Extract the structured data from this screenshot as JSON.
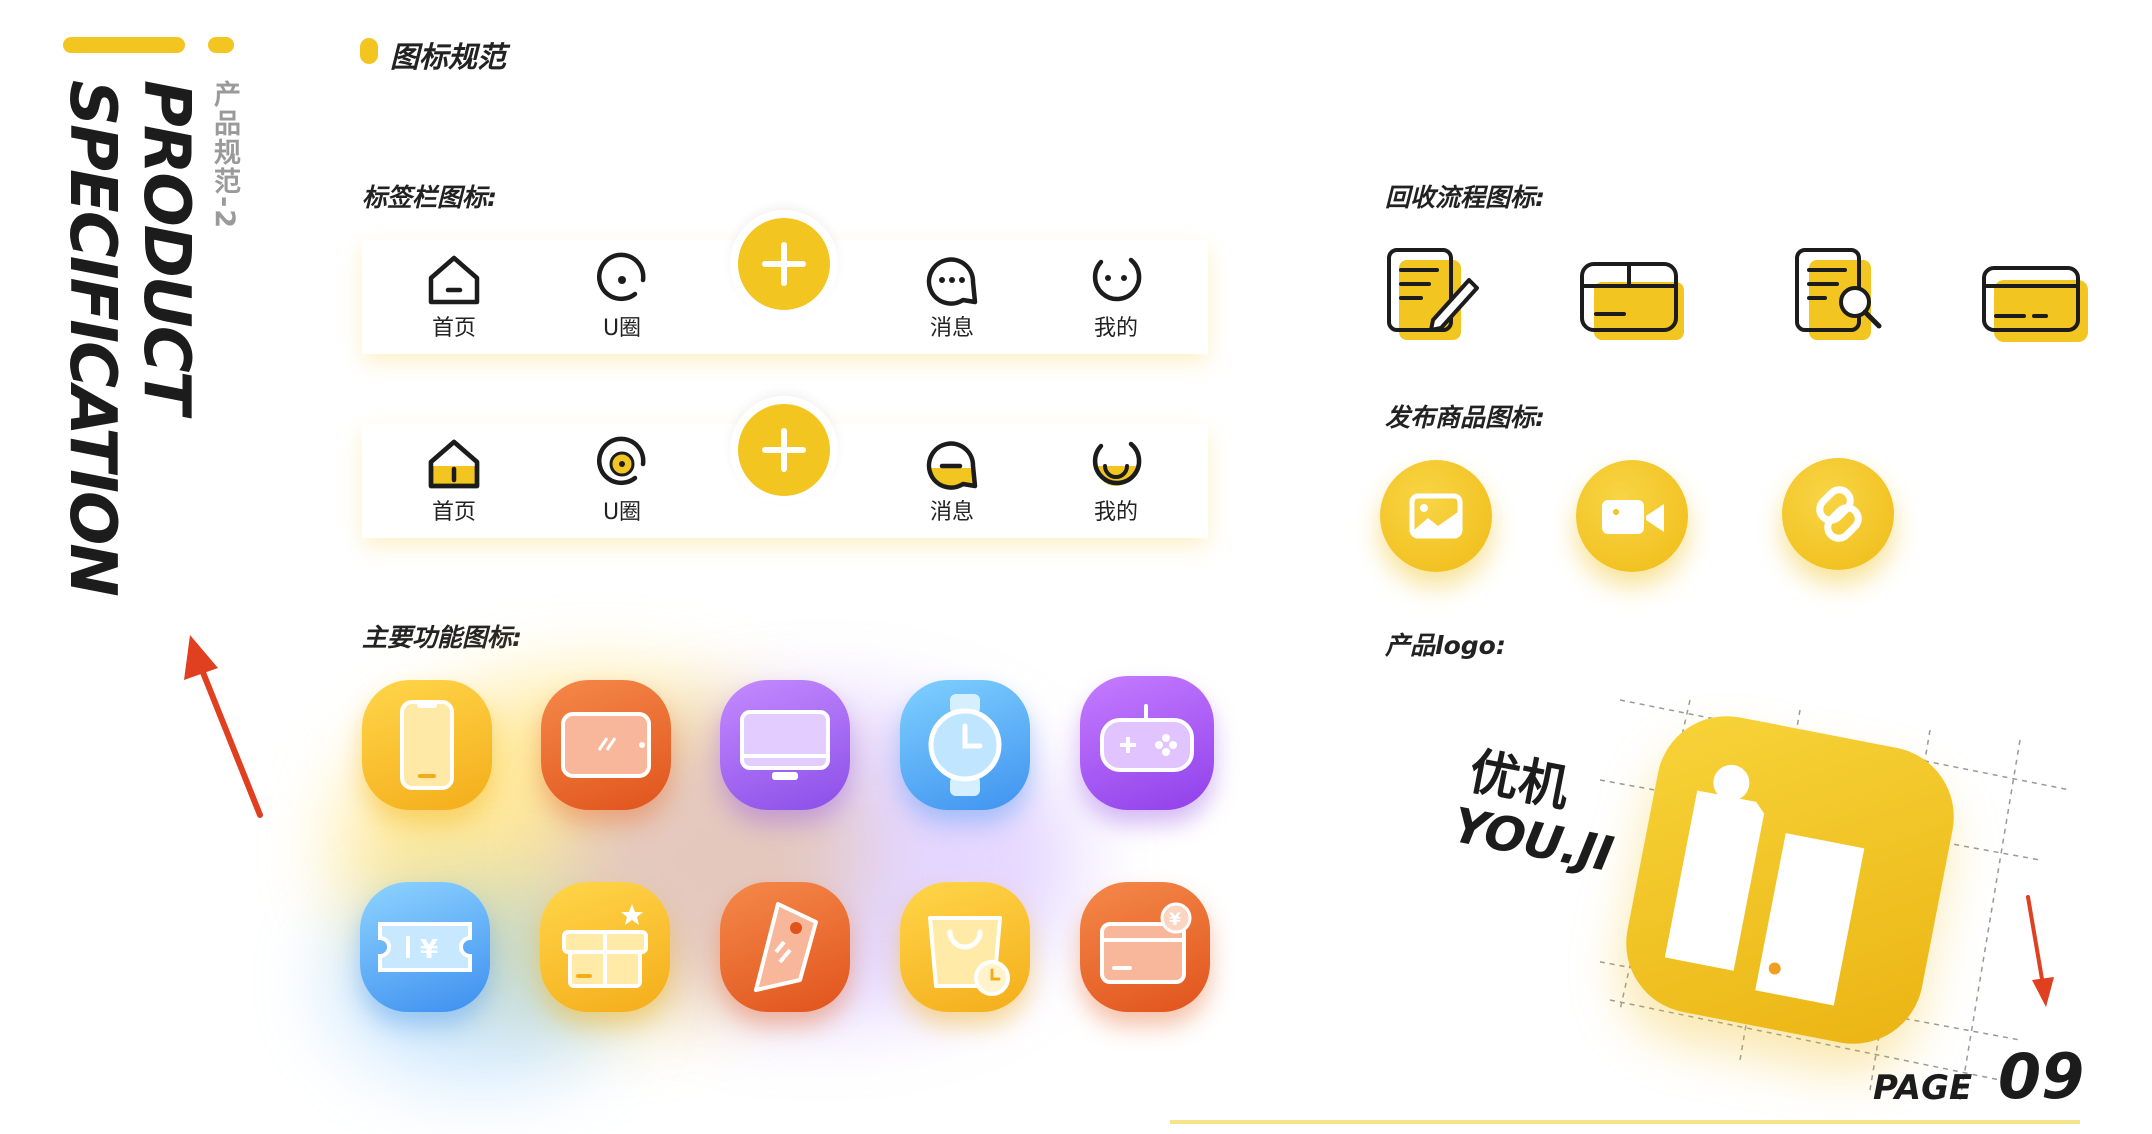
{
  "side": {
    "title_line1": "PRODUCT",
    "title_line2": "SPECIFICATION",
    "subtitle": "产品规范-2"
  },
  "heading": "图标规范",
  "sections": {
    "tabbar": "标签栏图标:",
    "main": "主要功能图标:",
    "recycle": "回收流程图标:",
    "publish": "发布商品图标:",
    "logo": "产品logo:"
  },
  "tabbar_labels": [
    "首页",
    "U圈",
    "消息",
    "我的"
  ],
  "logo": {
    "cn": "优机",
    "en": "YOU.JI"
  },
  "page": {
    "label": "PAGE",
    "number": "09"
  },
  "colors": {
    "accent": "#f2c521",
    "text": "#1c1c1c",
    "arrow": "#e0401f"
  },
  "icons": {
    "tabbar_outline": [
      "home-icon",
      "u-circle-icon",
      "add-icon",
      "message-icon",
      "profile-icon"
    ],
    "tabbar_filled": [
      "home-filled-icon",
      "u-circle-filled-icon",
      "add-icon",
      "message-filled-icon",
      "profile-filled-icon"
    ],
    "recycle": [
      "edit-document-icon",
      "box-icon",
      "search-document-icon",
      "card-icon"
    ],
    "publish": [
      "image-icon",
      "video-icon",
      "link-icon"
    ],
    "main": [
      "phone-icon",
      "tablet-icon",
      "monitor-icon",
      "watch-icon",
      "gamepad-icon",
      "ticket-icon",
      "gift-box-icon",
      "tag-icon",
      "shopping-bag-icon",
      "wallet-card-icon"
    ]
  }
}
